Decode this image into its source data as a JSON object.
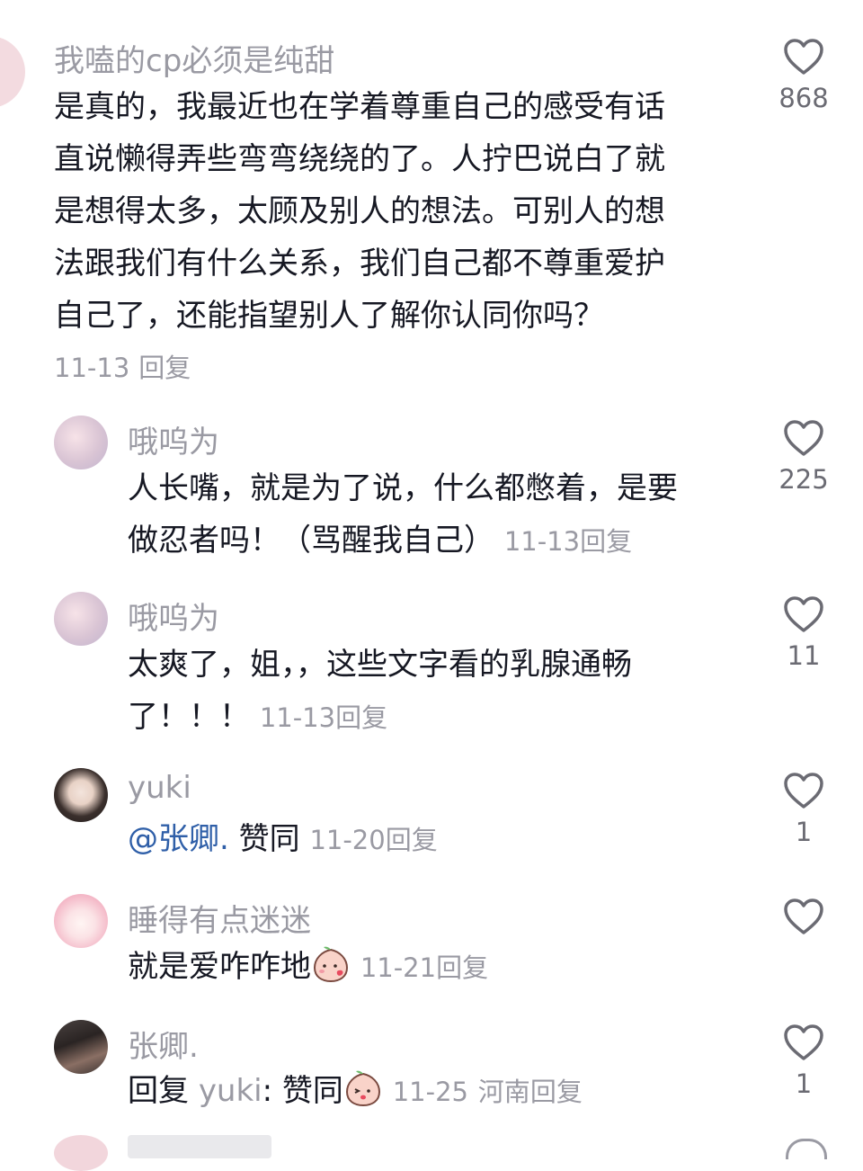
{
  "comments": [
    {
      "user": "我嗑的cp必须是纯甜",
      "lines": [
        "是真的，我最近也在学着尊重自己的感受有话",
        "直说懒得弄些弯弯绕绕的了。人拧巴说白了就",
        "是想得太多，太顾及别人的想法。可别人的想",
        "法跟我们有什么关系，我们自己都不尊重爱护",
        "自己了，还能指望别人了解你认同你吗？"
      ],
      "date": "11-13",
      "reply": "回复",
      "likes": "868"
    },
    {
      "user": "哦呜为",
      "lines": [
        "人长嘴，就是为了说，什么都憋着，是要",
        "做忍者吗！（骂醒我自己）"
      ],
      "date": "11-13",
      "reply": "回复",
      "likes": "225"
    },
    {
      "user": "哦呜为",
      "lines": [
        "太爽了，姐，，这些文字看的乳腺通畅",
        "了！！！"
      ],
      "date": "11-13",
      "reply": "回复",
      "likes": "11"
    },
    {
      "user": "yuki",
      "mention": "@张卿.",
      "text": "赞同",
      "date": "11-20",
      "reply": "回复",
      "likes": "1"
    },
    {
      "user": "睡得有点迷迷",
      "text": "就是爱咋咋地",
      "emoji": "peach-blush-emoji",
      "date": "11-21",
      "reply": "回复",
      "likes": ""
    },
    {
      "user": "张卿.",
      "reply_prefix": "回复",
      "reply_to": "yuki",
      "text": "赞同",
      "emoji": "peach-kiss-emoji",
      "date": "11-25",
      "location": "河南",
      "reply": "回复",
      "likes": "1"
    }
  ],
  "colors": {
    "text": "#161823",
    "meta": "#9a9aa3",
    "mention": "#2f5fa8"
  }
}
